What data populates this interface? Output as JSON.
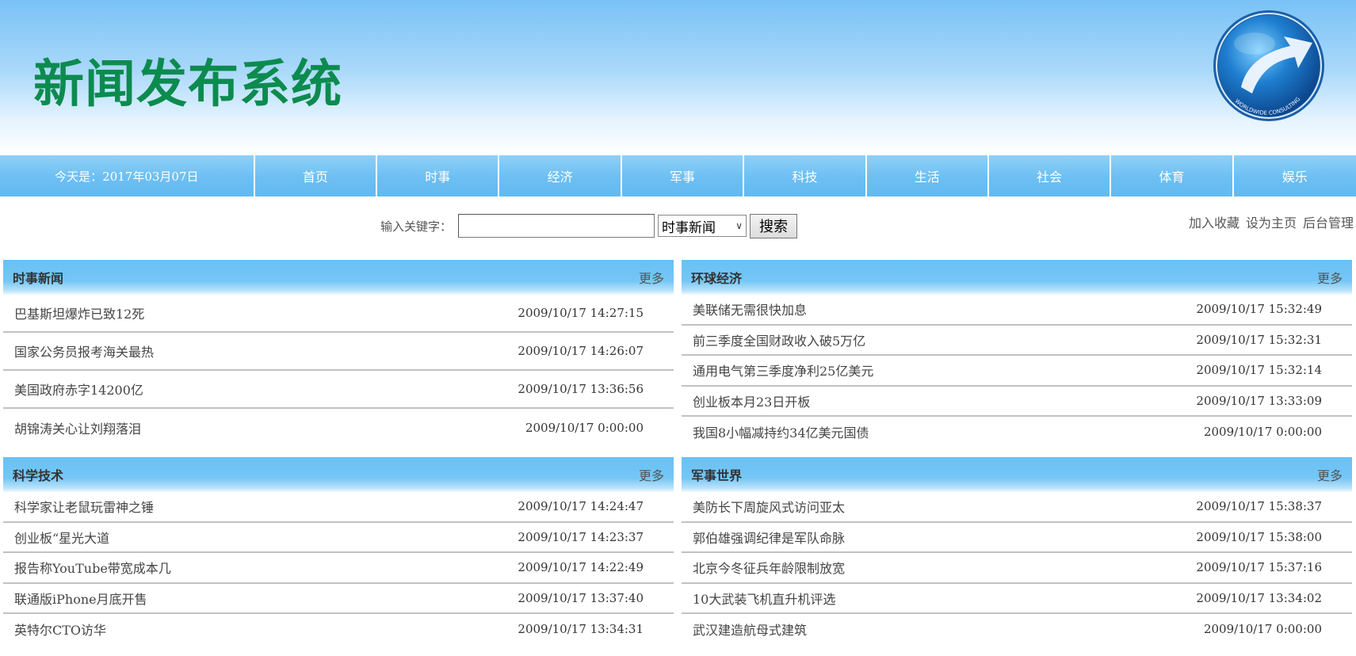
{
  "header": {
    "site_title": "新闻发布系统",
    "logo_icon": "globe-arrow-logo-icon",
    "logo_text": "WORLDWIDE CONSULTING"
  },
  "nav": {
    "date_text": "今天是：2017年03月07日",
    "items": [
      "首页",
      "时事",
      "经济",
      "军事",
      "科技",
      "生活",
      "社会",
      "体育",
      "娱乐"
    ]
  },
  "search": {
    "label": "输入关键字：",
    "input_value": "",
    "category_selected": "时事新闻",
    "button_label": "搜索"
  },
  "top_links": [
    "加入收藏",
    "设为主页",
    "后台管理"
  ],
  "panels": {
    "current": {
      "title": "时事新闻",
      "more": "更多",
      "rows": [
        {
          "title": "巴基斯坦爆炸已致12死",
          "time": "2009/10/17 14:27:15"
        },
        {
          "title": "国家公务员报考海关最热",
          "time": "2009/10/17 14:26:07"
        },
        {
          "title": "美国政府赤字14200亿",
          "time": "2009/10/17 13:36:56"
        },
        {
          "title": "胡锦涛关心让刘翔落泪",
          "time": "2009/10/17 0:00:00"
        }
      ]
    },
    "economy": {
      "title": "环球经济",
      "more": "更多",
      "rows": [
        {
          "title": "美联储无需很快加息",
          "time": "2009/10/17 15:32:49"
        },
        {
          "title": "前三季度全国财政收入破5万亿",
          "time": "2009/10/17 15:32:31"
        },
        {
          "title": "通用电气第三季度净利25亿美元",
          "time": "2009/10/17 15:32:14"
        },
        {
          "title": "创业板本月23日开板",
          "time": "2009/10/17 13:33:09"
        },
        {
          "title": "我国8小幅减持约34亿美元国债",
          "time": "2009/10/17 0:00:00"
        }
      ]
    },
    "tech": {
      "title": "科学技术",
      "more": "更多",
      "rows": [
        {
          "title": "科学家让老鼠玩雷神之锤",
          "time": "2009/10/17 14:24:47"
        },
        {
          "title": "创业板“星光大道",
          "time": "2009/10/17 14:23:37"
        },
        {
          "title": "报告称YouTube带宽成本几",
          "time": "2009/10/17 14:22:49"
        },
        {
          "title": "联通版iPhone月底开售",
          "time": "2009/10/17 13:37:40"
        },
        {
          "title": "英特尔CTO访华",
          "time": "2009/10/17 13:34:31"
        }
      ]
    },
    "military": {
      "title": "军事世界",
      "more": "更多",
      "rows": [
        {
          "title": "美防长下周旋风式访问亚太",
          "time": "2009/10/17 15:38:37"
        },
        {
          "title": "郭伯雄强调纪律是军队命脉",
          "time": "2009/10/17 15:38:00"
        },
        {
          "title": "北京今冬征兵年龄限制放宽",
          "time": "2009/10/17 15:37:16"
        },
        {
          "title": "10大武装飞机直升机评选",
          "time": "2009/10/17 13:34:02"
        },
        {
          "title": "武汉建造航母式建筑",
          "time": "2009/10/17 0:00:00"
        }
      ]
    }
  }
}
